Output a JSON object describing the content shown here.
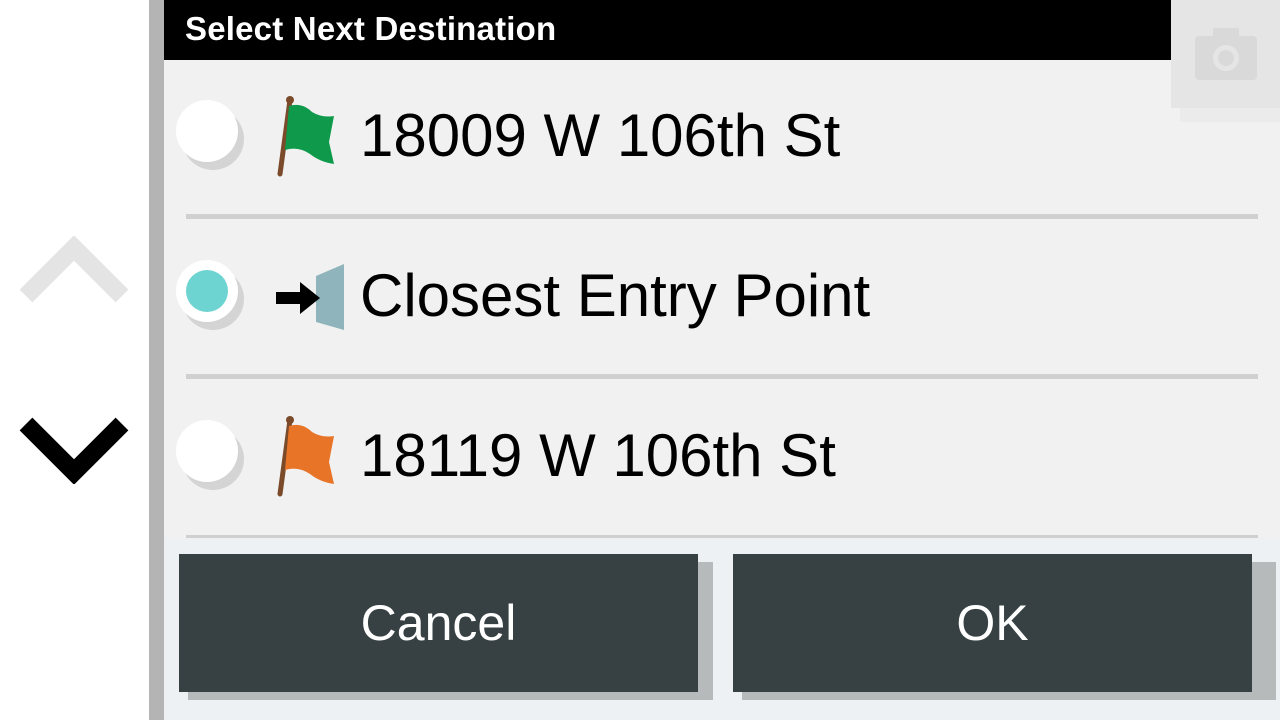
{
  "dialog": {
    "title": "Select Next Destination",
    "options": [
      {
        "label": "18009 W 106th St",
        "icon": "green-flag-icon",
        "icon_color": "#0e9a4a",
        "selected": false
      },
      {
        "label": "Closest Entry Point",
        "icon": "entry-point-icon",
        "icon_color": "#8fb4bb",
        "selected": true
      },
      {
        "label": "18119 W 106th St",
        "icon": "orange-flag-icon",
        "icon_color": "#e87428",
        "selected": false
      }
    ],
    "cancel_label": "Cancel",
    "ok_label": "OK"
  },
  "scroll": {
    "up_icon": "chevron-up-icon",
    "down_icon": "chevron-down-icon"
  },
  "colors": {
    "title_bar": "#000000",
    "dialog_bg": "#f1f1f1",
    "button_bg": "#374144",
    "radio_selected": "#6dd4d1"
  }
}
